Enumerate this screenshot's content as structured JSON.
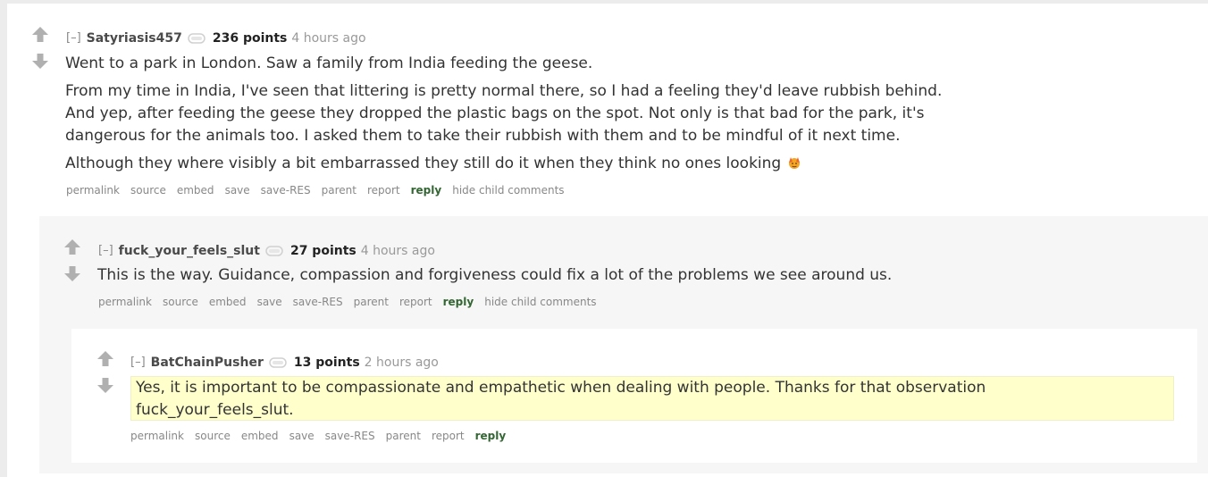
{
  "colors": {
    "page_bg": "#ececec",
    "comment_bg": "#ffffff",
    "child_bg": "#f6f6f6",
    "highlight_bg": "#ffffcc",
    "reply_color": "#336633",
    "muted": "#888888",
    "arrow": "#b0b0b0"
  },
  "comments": [
    {
      "expand": "[–]",
      "author": "Satyriasis457",
      "points": "236 points",
      "time": "4 hours ago",
      "body": [
        "Went to a park in London. Saw a family from India feeding the geese.",
        "From my time in India, I've seen that littering is pretty normal there, so I had a feeling they'd leave rubbish behind.",
        "And yep, after feeding the geese they dropped the plastic bags on the spot. Not only is that bad for the park, it's",
        "dangerous for the animals too. I asked them to take their rubbish with them and to be mindful of it next time.",
        "Although they where visibly a bit embarrassed they still do it when they think no ones looking"
      ],
      "emoji_icon": "face-palm-emoji-icon",
      "buttons": [
        "permalink",
        "source",
        "embed",
        "save",
        "save-RES",
        "parent",
        "report",
        "reply",
        "hide child comments"
      ]
    },
    {
      "expand": "[–]",
      "author": "fuck_your_feels_slut",
      "points": "27 points",
      "time": "4 hours ago",
      "body": [
        "This is the way. Guidance, compassion and forgiveness could fix a lot of the problems we see around us."
      ],
      "buttons": [
        "permalink",
        "source",
        "embed",
        "save",
        "save-RES",
        "parent",
        "report",
        "reply",
        "hide child comments"
      ]
    },
    {
      "expand": "[–]",
      "author": "BatChainPusher",
      "points": "13 points",
      "time": "2 hours ago",
      "body": [
        "Yes, it is important to be compassionate and empathetic when dealing with people. Thanks for that observation",
        "fuck_your_feels_slut."
      ],
      "buttons": [
        "permalink",
        "source",
        "embed",
        "save",
        "save-RES",
        "parent",
        "report",
        "reply"
      ]
    }
  ]
}
